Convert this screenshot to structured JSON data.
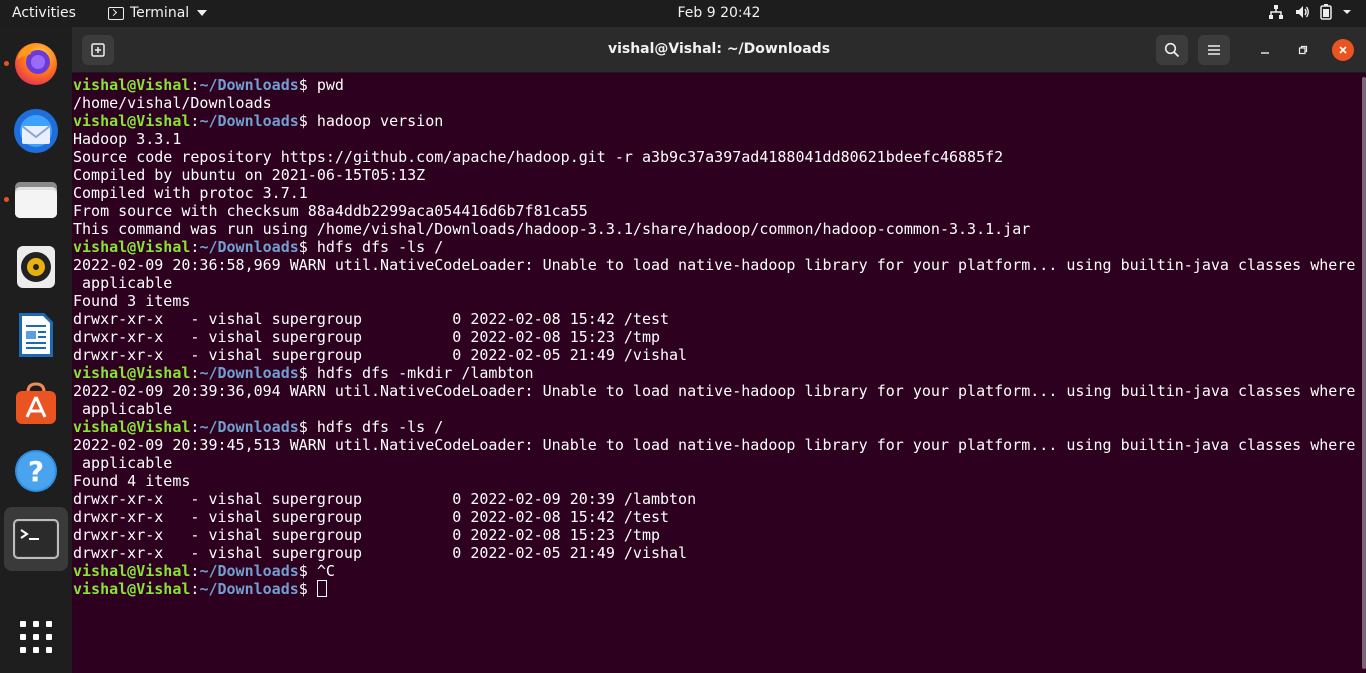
{
  "topbar": {
    "activities": "Activities",
    "app_menu": "Terminal",
    "clock": "Feb 9  20:42",
    "icons": [
      "network-icon",
      "volume-icon",
      "battery-icon",
      "power-menu-icon"
    ]
  },
  "dock": {
    "items": [
      {
        "name": "Firefox",
        "icon": "firefox-icon"
      },
      {
        "name": "Thunderbird",
        "icon": "thunderbird-icon"
      },
      {
        "name": "Files",
        "icon": "files-icon"
      },
      {
        "name": "Rhythmbox",
        "icon": "rhythmbox-icon"
      },
      {
        "name": "LibreOffice Writer",
        "icon": "writer-icon"
      },
      {
        "name": "Ubuntu Software",
        "icon": "software-icon"
      },
      {
        "name": "Help",
        "icon": "help-icon"
      },
      {
        "name": "Terminal",
        "icon": "terminal-icon"
      },
      {
        "name": "Show Applications",
        "icon": "app-grid-icon"
      }
    ]
  },
  "window": {
    "title": "vishal@Vishal: ~/Downloads"
  },
  "terminal": {
    "prompt_user": "vishal@Vishal",
    "prompt_path": "~/Downloads",
    "lines": [
      {
        "type": "cmd",
        "text": " pwd"
      },
      {
        "type": "out",
        "text": "/home/vishal/Downloads"
      },
      {
        "type": "cmd",
        "text": " hadoop version"
      },
      {
        "type": "out",
        "text": "Hadoop 3.3.1"
      },
      {
        "type": "out",
        "text": "Source code repository https://github.com/apache/hadoop.git -r a3b9c37a397ad4188041dd80621bdeefc46885f2"
      },
      {
        "type": "out",
        "text": "Compiled by ubuntu on 2021-06-15T05:13Z"
      },
      {
        "type": "out",
        "text": "Compiled with protoc 3.7.1"
      },
      {
        "type": "out",
        "text": "From source with checksum 88a4ddb2299aca054416d6b7f81ca55"
      },
      {
        "type": "out",
        "text": "This command was run using /home/vishal/Downloads/hadoop-3.3.1/share/hadoop/common/hadoop-common-3.3.1.jar"
      },
      {
        "type": "cmd",
        "text": " hdfs dfs -ls /"
      },
      {
        "type": "out",
        "text": "2022-02-09 20:36:58,969 WARN util.NativeCodeLoader: Unable to load native-hadoop library for your platform... using builtin-java classes where"
      },
      {
        "type": "out",
        "text": " applicable"
      },
      {
        "type": "out",
        "text": "Found 3 items"
      },
      {
        "type": "out",
        "text": "drwxr-xr-x   - vishal supergroup          0 2022-02-08 15:42 /test"
      },
      {
        "type": "out",
        "text": "drwxr-xr-x   - vishal supergroup          0 2022-02-08 15:23 /tmp"
      },
      {
        "type": "out",
        "text": "drwxr-xr-x   - vishal supergroup          0 2022-02-05 21:49 /vishal"
      },
      {
        "type": "cmd",
        "text": " hdfs dfs -mkdir /lambton"
      },
      {
        "type": "out",
        "text": "2022-02-09 20:39:36,094 WARN util.NativeCodeLoader: Unable to load native-hadoop library for your platform... using builtin-java classes where"
      },
      {
        "type": "out",
        "text": " applicable"
      },
      {
        "type": "cmd",
        "text": " hdfs dfs -ls /"
      },
      {
        "type": "out",
        "text": "2022-02-09 20:39:45,513 WARN util.NativeCodeLoader: Unable to load native-hadoop library for your platform... using builtin-java classes where"
      },
      {
        "type": "out",
        "text": " applicable"
      },
      {
        "type": "out",
        "text": "Found 4 items"
      },
      {
        "type": "out",
        "text": "drwxr-xr-x   - vishal supergroup          0 2022-02-09 20:39 /lambton"
      },
      {
        "type": "out",
        "text": "drwxr-xr-x   - vishal supergroup          0 2022-02-08 15:42 /test"
      },
      {
        "type": "out",
        "text": "drwxr-xr-x   - vishal supergroup          0 2022-02-08 15:23 /tmp"
      },
      {
        "type": "out",
        "text": "drwxr-xr-x   - vishal supergroup          0 2022-02-05 21:49 /vishal"
      },
      {
        "type": "cmd",
        "text": " ^C"
      },
      {
        "type": "prompt_cursor",
        "text": " "
      }
    ]
  },
  "colors": {
    "terminal_bg": "#2c001e",
    "prompt_user": "#8ae234",
    "prompt_path": "#729fcf",
    "accent": "#e95420"
  }
}
